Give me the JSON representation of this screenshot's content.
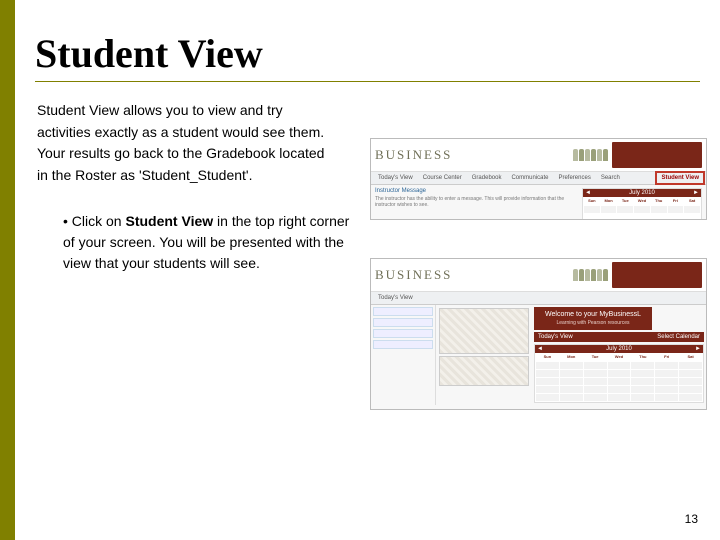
{
  "title": "Student View",
  "paragraph": "Student View allows you to view and try activities exactly as a student would see them. Your results go back to the Gradebook located in the Roster as 'Student_Student'.",
  "bullet": {
    "prefix": "• Click on ",
    "bold": "Student View",
    "suffix": " in the top right corner of your screen. You will be presented with the view that your students will see."
  },
  "page_number": "13",
  "shot_common": {
    "logo": "BUSINESS",
    "student_view_link": "Student View"
  },
  "shot1": {
    "tabs": [
      "Today's View",
      "Course Center",
      "Gradebook",
      "Communicate",
      "Preferences",
      "Search"
    ],
    "msg_link": "Instructor Message",
    "msg_body": "The instructor has the ability to enter a message. This will provide information that the instructor wishes to see.",
    "cal_header": "July 2010",
    "days": [
      "Sun",
      "Mon",
      "Tue",
      "Wed",
      "Thu",
      "Fri",
      "Sat"
    ]
  },
  "shot2": {
    "tabs": [
      "Today's View"
    ],
    "welcome_title": "Welcome to your MyBusinessL",
    "welcome_sub": "Learning with Pearson resources",
    "toolbar_left": "Today's View",
    "toolbar_right": "Select Calendar",
    "cal_header": "July 2010",
    "days": [
      "Sun",
      "Mon",
      "Tue",
      "Wed",
      "Thu",
      "Fri",
      "Sat"
    ]
  }
}
